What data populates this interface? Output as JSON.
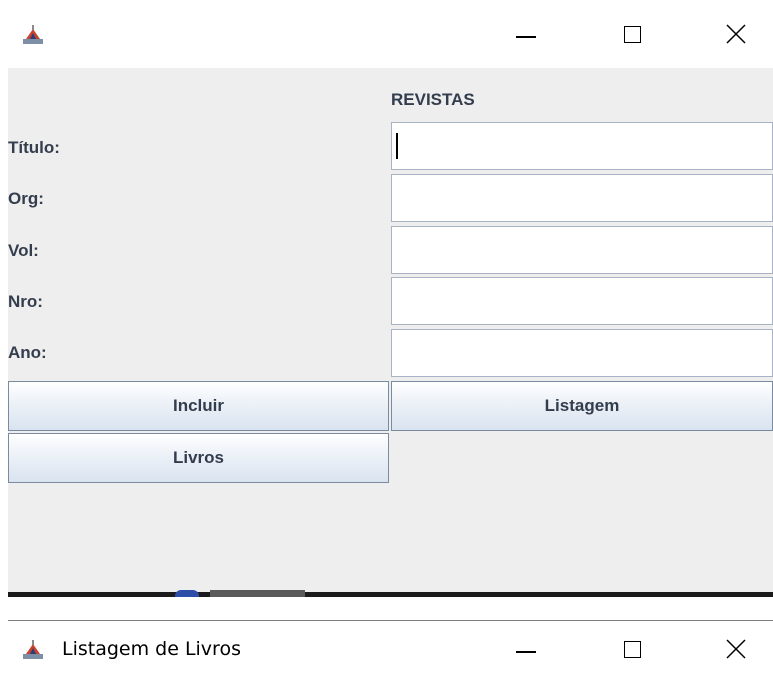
{
  "window1": {
    "icon": "java-cup-icon",
    "controls": {
      "minimize": "minimize-icon",
      "maximize": "maximize-icon",
      "close": "close-icon"
    }
  },
  "form": {
    "heading": "REVISTAS",
    "labels": {
      "titulo": "Título:",
      "org": "Org:",
      "vol": "Vol:",
      "nro": "Nro:",
      "ano": "Ano:"
    },
    "values": {
      "titulo": "",
      "org": "",
      "vol": "",
      "nro": "",
      "ano": ""
    },
    "buttons": {
      "incluir": "Incluir",
      "listagem": "Listagem",
      "livros": "Livros"
    }
  },
  "window2": {
    "title": "Listagem de Livros",
    "icon": "java-cup-icon",
    "controls": {
      "minimize": "minimize-icon",
      "maximize": "maximize-icon",
      "close": "close-icon"
    }
  },
  "colors": {
    "panel": "#eeeeee",
    "label_text": "#333d4d",
    "field_border": "#a8b3c4",
    "button_border": "#7a8a9f"
  }
}
